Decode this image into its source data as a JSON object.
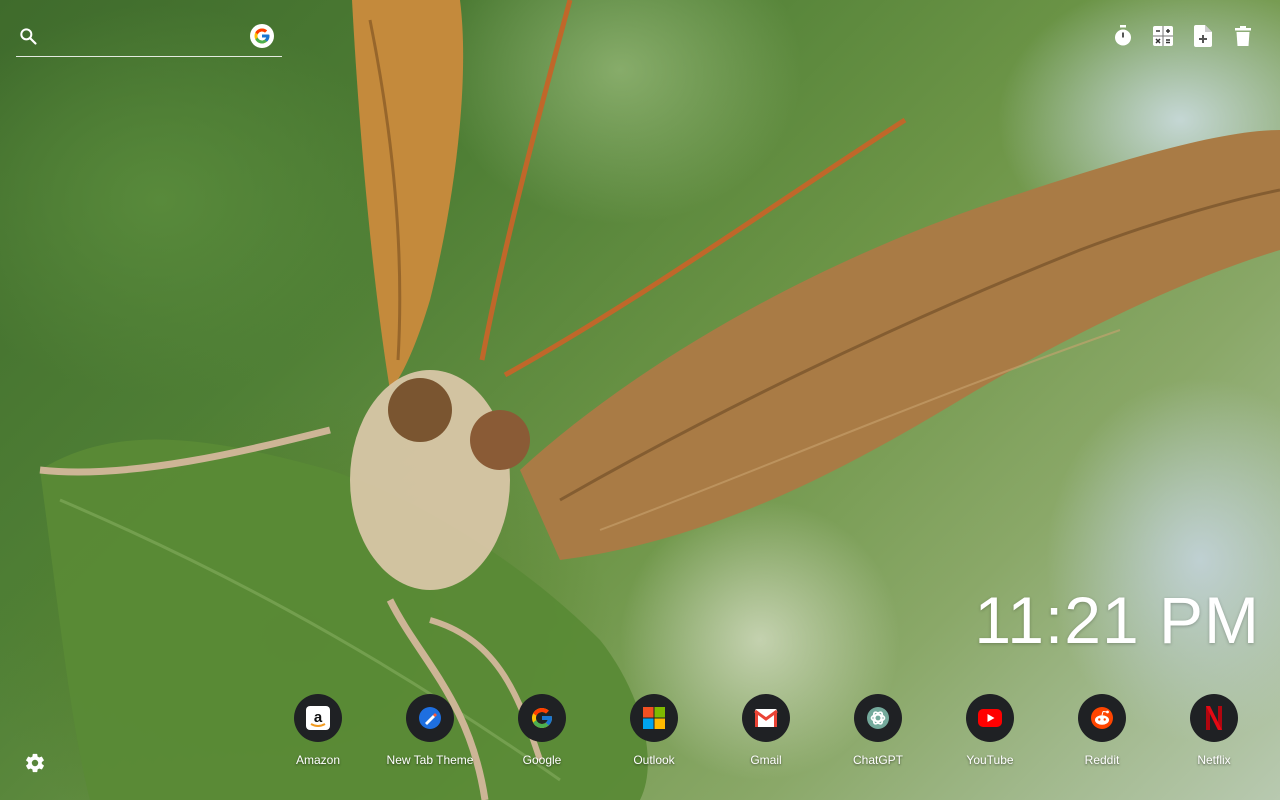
{
  "search": {
    "placeholder": "",
    "value": "",
    "engine_icon": "google-icon"
  },
  "toolbar": {
    "icons": [
      "timer-icon",
      "calculator-icon",
      "add-file-icon",
      "trash-icon"
    ]
  },
  "clock": {
    "time": "11:21 PM"
  },
  "shortcuts": [
    {
      "label": "Amazon",
      "icon": "amazon-icon"
    },
    {
      "label": "New Tab Theme",
      "icon": "new-tab-theme-icon"
    },
    {
      "label": "Google",
      "icon": "google-icon"
    },
    {
      "label": "Outlook",
      "icon": "microsoft-icon"
    },
    {
      "label": "Gmail",
      "icon": "gmail-icon"
    },
    {
      "label": "ChatGPT",
      "icon": "chatgpt-icon"
    },
    {
      "label": "YouTube",
      "icon": "youtube-icon"
    },
    {
      "label": "Reddit",
      "icon": "reddit-icon"
    },
    {
      "label": "Netflix",
      "icon": "netflix-icon"
    }
  ],
  "settings": {
    "icon": "gear-icon"
  },
  "colors": {
    "icon_circle": "#1f2124",
    "wing_brown": "#9a6a35",
    "leaf_green": "#4f7f35"
  }
}
